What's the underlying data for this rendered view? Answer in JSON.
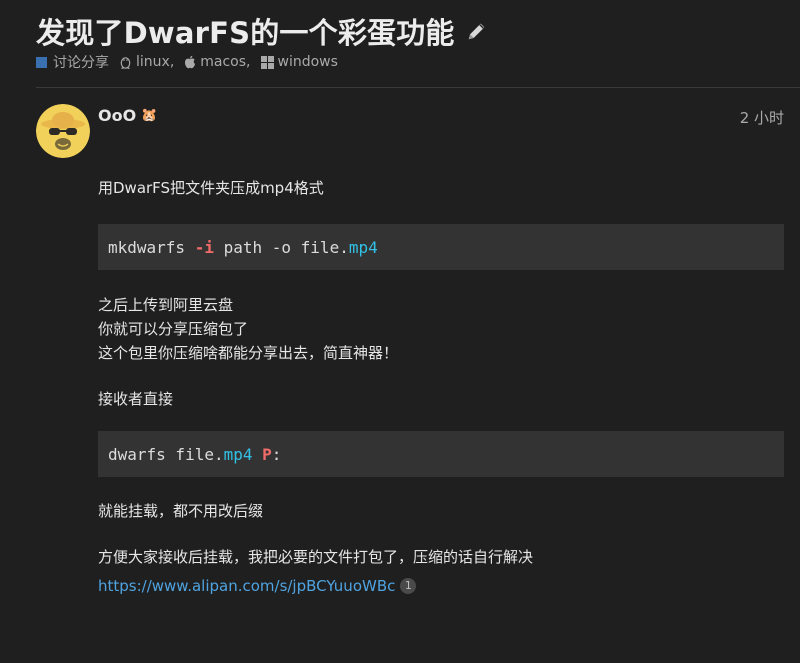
{
  "topic": {
    "title": "发现了DwarFS的一个彩蛋功能",
    "category": "讨论分享",
    "tags": [
      "linux",
      "macos",
      "windows"
    ],
    "tag_separator": ","
  },
  "post": {
    "username": "OoO",
    "flair": "🐹",
    "date": "2 小时",
    "paragraphs": {
      "p1": "用DwarFS把文件夹压成mp4格式",
      "p2_line1": "之后上传到阿里云盘",
      "p2_line2": "你就可以分享压缩包了",
      "p2_line3": "这个包里你压缩啥都能分享出去，简直神器！",
      "p3": "接收者直接",
      "p4": "就能挂载，都不用改后缀",
      "p5": "方便大家接收后挂载，我把必要的文件打包了，压缩的话自行解决"
    },
    "code1": {
      "cmd": "mkdwarfs ",
      "flag": "-i",
      "mid": " path -o file.",
      "ext": "mp4"
    },
    "code2": {
      "cmd": "dwarfs file.",
      "ext": "mp4",
      "space": " ",
      "drive": "P",
      "tail": ":"
    },
    "link": {
      "text": "https://www.alipan.com/s/jpBCYuuoWBc",
      "clicks": "1"
    }
  },
  "colors": {
    "background": "#1f1f1f",
    "category": "#3a6fb0",
    "link": "#4fa3e0",
    "code_bg": "#333333"
  },
  "icons": {
    "edit": "pencil-icon",
    "linux": "penguin-icon",
    "macos": "apple-icon",
    "windows": "windows-icon"
  }
}
